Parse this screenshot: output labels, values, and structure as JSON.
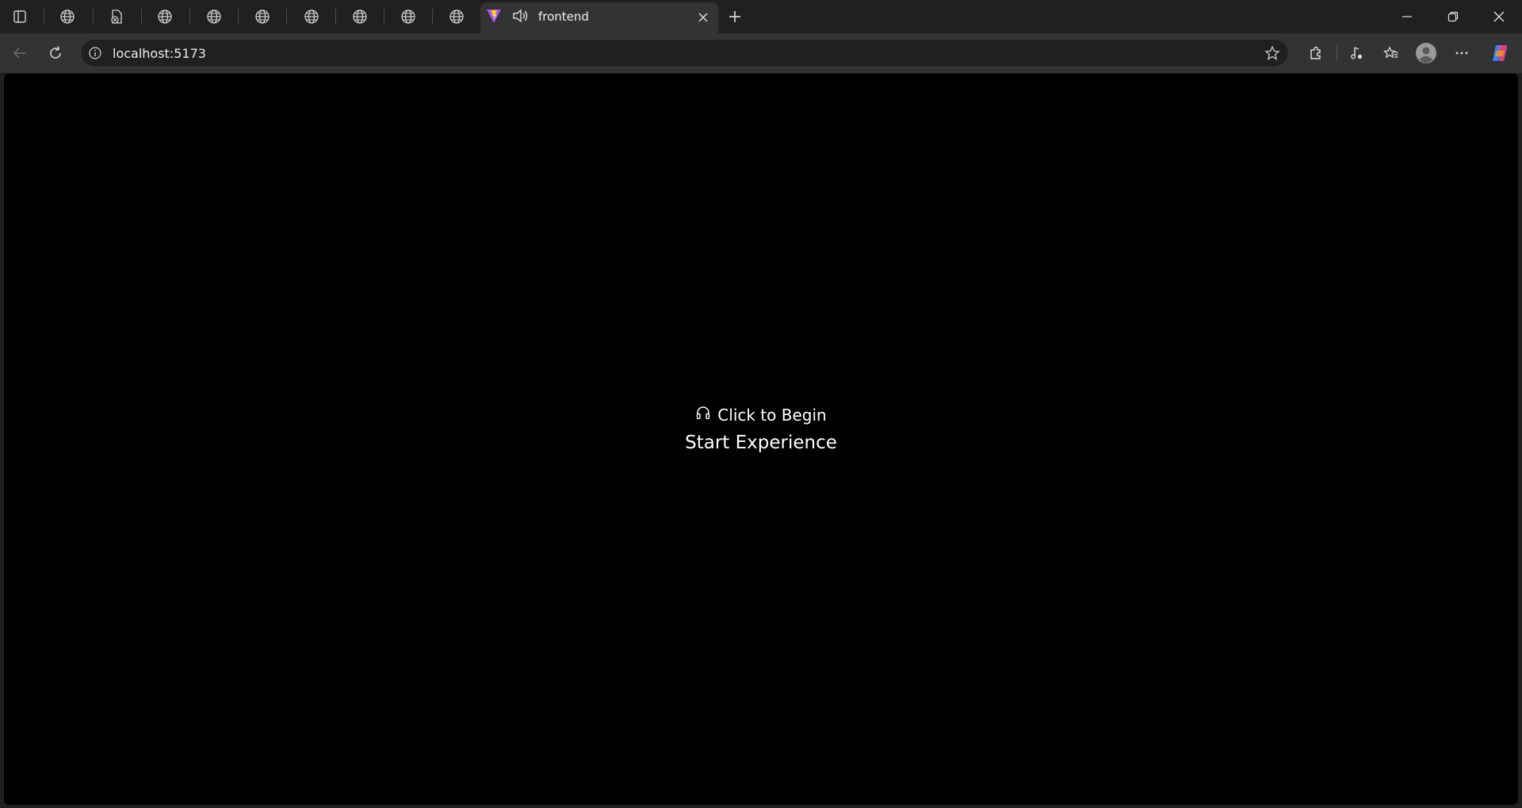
{
  "browser": {
    "active_tab": {
      "title": "frontend",
      "favicon": "vite-logo-icon",
      "audio_icon": "speaker-icon"
    },
    "background_tabs": [
      {
        "icon": "globe-icon"
      },
      {
        "icon": "file-error-icon"
      },
      {
        "icon": "globe-icon"
      },
      {
        "icon": "globe-icon"
      },
      {
        "icon": "globe-icon"
      },
      {
        "icon": "globe-icon"
      },
      {
        "icon": "globe-icon"
      },
      {
        "icon": "globe-icon"
      },
      {
        "icon": "globe-icon"
      }
    ],
    "address": {
      "url": "localhost:5173"
    }
  },
  "page": {
    "begin_label": "Click to Begin",
    "begin_icon": "headphones-icon",
    "start_button_label": "Start Experience"
  },
  "colors": {
    "titlebar": "#202020",
    "toolbar": "#333333",
    "page_background": "#000000",
    "page_text": "#ffffff"
  }
}
